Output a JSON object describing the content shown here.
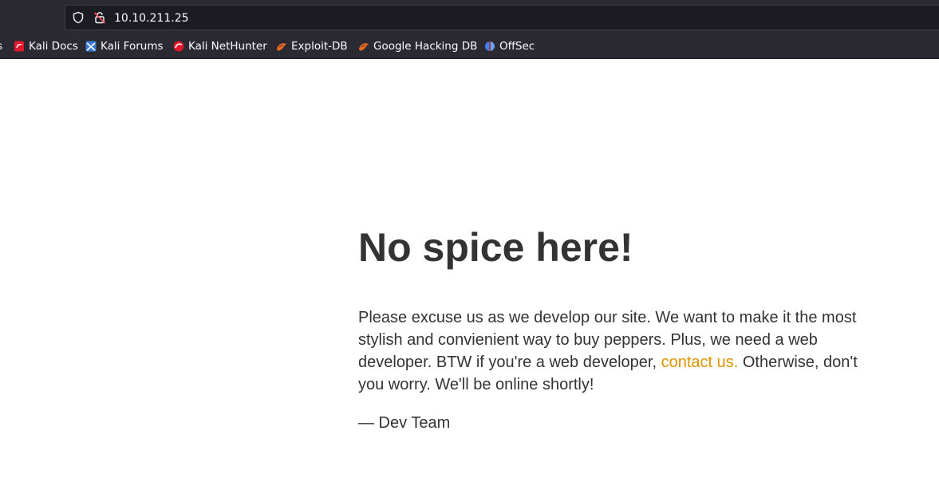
{
  "browser": {
    "url": "10.10.211.25",
    "bookmarks": [
      {
        "label": "s",
        "icon": "kali-icon"
      },
      {
        "label": "Kali Docs",
        "icon": "kali-docs-icon"
      },
      {
        "label": "Kali Forums",
        "icon": "kali-forums-icon"
      },
      {
        "label": "Kali NetHunter",
        "icon": "kali-nethunter-icon"
      },
      {
        "label": "Exploit-DB",
        "icon": "exploit-db-icon"
      },
      {
        "label": "Google Hacking DB",
        "icon": "exploit-db-icon"
      },
      {
        "label": "OffSec",
        "icon": "offsec-icon"
      }
    ]
  },
  "page": {
    "title": "No spice here!",
    "message_part1": "Please excuse us as we develop our site. We want to make it the most stylish and convienient way to buy peppers. Plus, we need a web developer. BTW if you're a web developer, ",
    "contact_link": "contact us.",
    "message_part2": " Otherwise, don't you worry. We'll be online shortly!",
    "signoff": "— Dev Team"
  },
  "colors": {
    "chrome_bg": "#2b2a33",
    "text": "#333333",
    "link": "#dd9400"
  }
}
